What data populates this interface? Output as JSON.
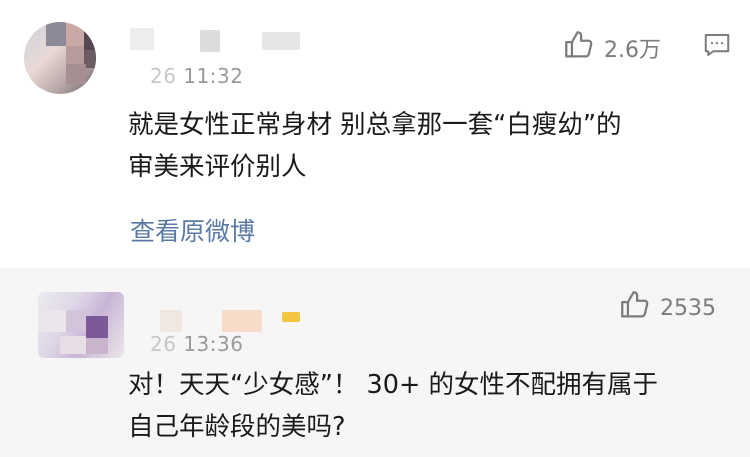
{
  "comments": [
    {
      "time": "11:32",
      "time_prefix": "26",
      "text_line1": "就是女性正常身材 别总拿那一套“白瘦幼”的",
      "text_line2": "审美来评价别人",
      "likes": "2.6万",
      "link": "查看原微博",
      "icons": {
        "like": "thumbs-up-icon",
        "reply": "comment-icon"
      }
    },
    {
      "time": "13:36",
      "time_prefix": "26",
      "text_line1": "对！天天“少女感”！ 30+ 的女性不配拥有属于",
      "text_line2": "自己年龄段的美吗?",
      "likes": "2535",
      "icons": {
        "like": "thumbs-up-icon"
      }
    }
  ],
  "colors": {
    "link": "#5a7aa6",
    "secondary": "#9a9a9a",
    "muted_bg": "#f6f6f6"
  }
}
